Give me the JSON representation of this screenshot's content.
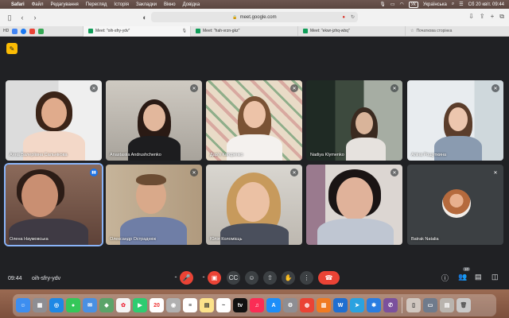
{
  "menubar": {
    "apple": "",
    "items": [
      "Safari",
      "Файл",
      "Редагування",
      "Перегляд",
      "Історія",
      "Закладки",
      "Вікно",
      "Довідка"
    ],
    "input_source": "Українська",
    "input_badge": "УК",
    "datetime": "Сб 20 квіт.  09:44"
  },
  "toolbar": {
    "address": "meet.google.com"
  },
  "favorites": {
    "label": "HD"
  },
  "tabs": [
    {
      "title": "Meet: \"oih-sfry-ydv\"",
      "active": true
    },
    {
      "title": "Meet: \"hah-vrzn-gkz\"",
      "active": false
    },
    {
      "title": "Meet: \"ekwr-jzhq-wbq\"",
      "active": false
    },
    {
      "title": "Початкова сторінка",
      "active": false
    }
  ],
  "participants": [
    {
      "name": "Анна Валеріївна Сальнікова",
      "muted": true
    },
    {
      "name": "Anastasiia Andrushchenko",
      "muted": true
    },
    {
      "name": "Дар'я Катєренко",
      "muted": true
    },
    {
      "name": "Nadiya Klymenko",
      "muted": true
    },
    {
      "name": "Аліна Рощупкина",
      "muted": true
    },
    {
      "name": "Олена Наумовська",
      "muted": false,
      "speaking": true
    },
    {
      "name": "Олександр Остраднюк",
      "muted": true
    },
    {
      "name": "Юлія Коломієць",
      "muted": true
    },
    {
      "name": "",
      "muted": true
    },
    {
      "name": "Batrak Natalia",
      "muted": true
    }
  ],
  "meeting": {
    "time": "09:44",
    "code": "oih-sfry-ydv",
    "participants_count": "10"
  },
  "dock": {
    "calendar_day": "20"
  },
  "colors": {
    "meet_bg": "#202124",
    "control_bg": "#3c4043",
    "end_call": "#ea4335",
    "speaking": "#1a73e8"
  }
}
